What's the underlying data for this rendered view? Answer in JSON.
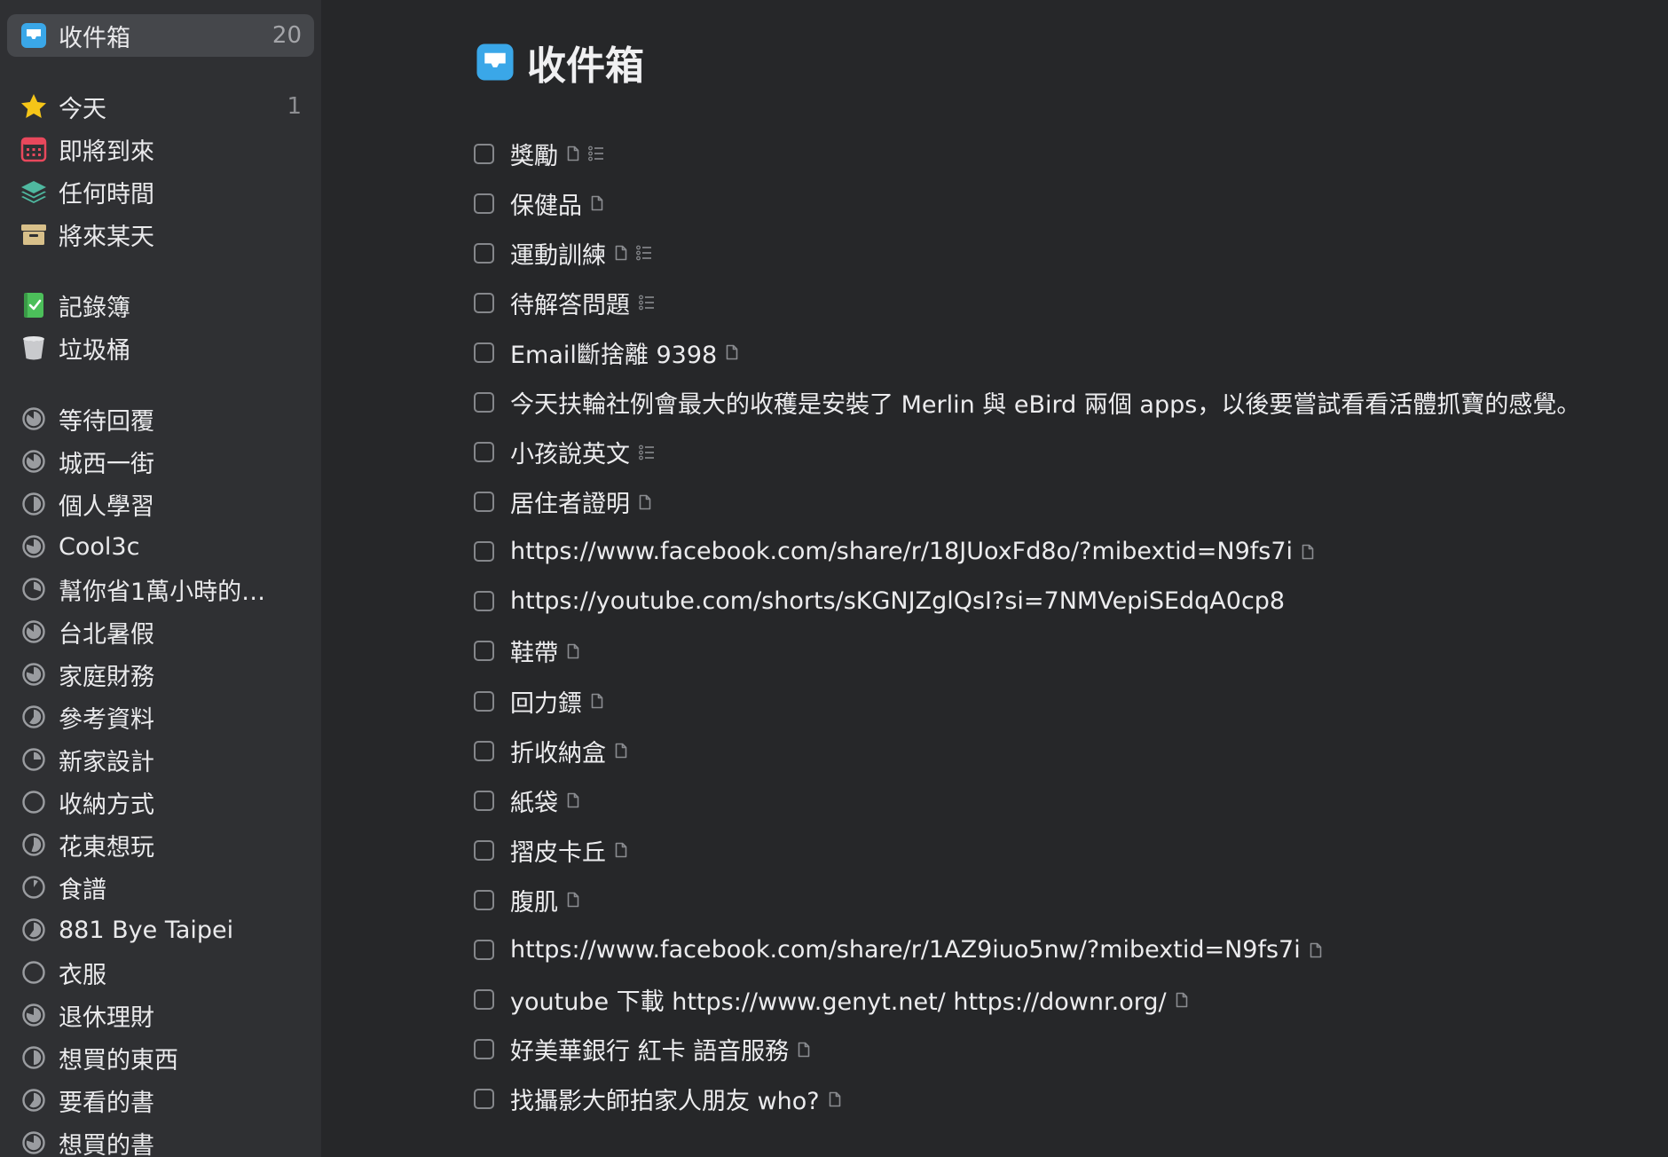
{
  "sidebar": {
    "inbox": {
      "label": "收件箱",
      "count": "20",
      "icon": "inbox-icon"
    },
    "today": {
      "label": "今天",
      "count": "1",
      "icon": "star-icon"
    },
    "upcoming": {
      "label": "即將到來",
      "icon": "calendar-icon"
    },
    "anytime": {
      "label": "任何時間",
      "icon": "layers-icon"
    },
    "someday": {
      "label": "將來某天",
      "icon": "archive-box-icon"
    },
    "logbook": {
      "label": "記錄簿",
      "icon": "logbook-icon"
    },
    "trash": {
      "label": "垃圾桶",
      "icon": "trash-icon"
    },
    "projects": [
      {
        "label": "等待回覆",
        "progress": 0.85
      },
      {
        "label": "城西一街",
        "progress": 0.85
      },
      {
        "label": "個人學習",
        "progress": 0.5
      },
      {
        "label": "Cool3c",
        "progress": 0.8
      },
      {
        "label": "幫你省1萬小時的…",
        "progress": 0.3
      },
      {
        "label": "台北暑假",
        "progress": 0.85
      },
      {
        "label": "家庭財務",
        "progress": 0.8
      },
      {
        "label": "參考資料",
        "progress": 0.6
      },
      {
        "label": "新家設計",
        "progress": 0.25
      },
      {
        "label": "收納方式",
        "progress": 0
      },
      {
        "label": "花東想玩",
        "progress": 0.55
      },
      {
        "label": "食譜",
        "progress": 0.1
      },
      {
        "label": "881 Bye Taipei",
        "progress": 0.6
      },
      {
        "label": "衣服",
        "progress": 0
      },
      {
        "label": "退休理財",
        "progress": 0.8
      },
      {
        "label": "想買的東西",
        "progress": 0.5
      },
      {
        "label": "要看的書",
        "progress": 0.6
      },
      {
        "label": "想買的書",
        "progress": 0.8
      }
    ]
  },
  "main": {
    "title": "收件箱",
    "title_icon": "inbox-icon",
    "tasks": [
      {
        "title": "獎勵",
        "note": true,
        "checklist": true
      },
      {
        "title": "保健品",
        "note": true,
        "checklist": false
      },
      {
        "title": "運動訓練",
        "note": true,
        "checklist": true
      },
      {
        "title": "待解答問題",
        "note": false,
        "checklist": true
      },
      {
        "title": "Email斷捨離 9398",
        "note": true,
        "checklist": false
      },
      {
        "title": "今天扶輪社例會最大的收穫是安裝了 Merlin 與 eBird 兩個 apps，以後要嘗試看看活體抓寶的感覺。",
        "note": false,
        "checklist": false
      },
      {
        "title": "小孩說英文",
        "note": false,
        "checklist": true
      },
      {
        "title": "居住者證明",
        "note": true,
        "checklist": false
      },
      {
        "title": "https://www.facebook.com/share/r/18JUoxFd8o/?mibextid=N9fs7i",
        "note": true,
        "checklist": false
      },
      {
        "title": "https://youtube.com/shorts/sKGNJZglQsI?si=7NMVepiSEdqA0cp8",
        "note": false,
        "checklist": false
      },
      {
        "title": "鞋帶",
        "note": true,
        "checklist": false
      },
      {
        "title": "回力鏢",
        "note": true,
        "checklist": false
      },
      {
        "title": "折收納盒",
        "note": true,
        "checklist": false
      },
      {
        "title": "紙袋",
        "note": true,
        "checklist": false
      },
      {
        "title": "摺皮卡丘",
        "note": true,
        "checklist": false
      },
      {
        "title": "腹肌",
        "note": true,
        "checklist": false
      },
      {
        "title": "https://www.facebook.com/share/r/1AZ9iuo5nw/?mibextid=N9fs7i",
        "note": true,
        "checklist": false
      },
      {
        "title": "youtube 下載 https://www.genyt.net/ https://downr.org/",
        "note": true,
        "checklist": false
      },
      {
        "title": "好美華銀行 紅卡 語音服務",
        "note": true,
        "checklist": false
      },
      {
        "title": "找攝影大師拍家人朋友 who?",
        "note": true,
        "checklist": false
      }
    ]
  },
  "colors": {
    "inbox": "#3aa7e8",
    "star": "#f5c518",
    "calendar": "#e8485c",
    "layers": "#4fb8a0",
    "archive": "#d8c08a",
    "logbook": "#4cbf5a",
    "progress": "#9a9ca0"
  }
}
